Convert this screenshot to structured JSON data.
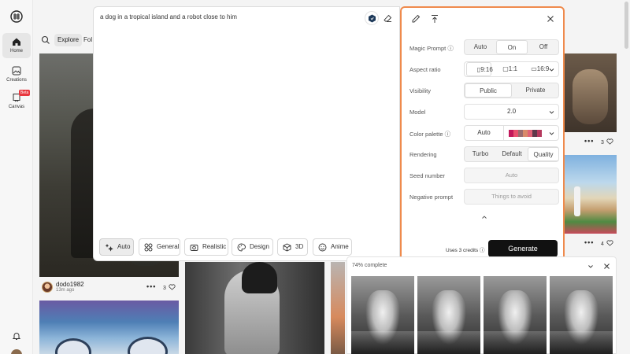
{
  "sidebar": {
    "items": [
      {
        "label": "Home",
        "icon": "home-icon"
      },
      {
        "label": "Creations",
        "icon": "image-icon"
      },
      {
        "label": "Canvas",
        "icon": "canvas-icon",
        "badge": "Beta"
      }
    ]
  },
  "header": {
    "tabs": [
      {
        "label": "Explore"
      },
      {
        "label": "Fol"
      }
    ]
  },
  "prompt": {
    "text": "a dog in a tropical island and a robot close to him"
  },
  "styles": [
    {
      "label": "Auto",
      "icon": "sparkle-icon"
    },
    {
      "label": "General",
      "icon": "grid-icon"
    },
    {
      "label": "Realistic",
      "icon": "camera-icon"
    },
    {
      "label": "Design",
      "icon": "palette-icon"
    },
    {
      "label": "3D",
      "icon": "cube-icon"
    },
    {
      "label": "Anime",
      "icon": "smile-icon"
    }
  ],
  "settings": {
    "magic_prompt": {
      "label": "Magic Prompt",
      "options": [
        "Auto",
        "On",
        "Off"
      ],
      "selected": "On"
    },
    "aspect_ratio": {
      "label": "Aspect ratio",
      "options": [
        "9:16",
        "1:1",
        "16:9"
      ],
      "selected": "9:16"
    },
    "visibility": {
      "label": "Visibility",
      "options": [
        "Public",
        "Private"
      ],
      "selected": "Public"
    },
    "model": {
      "label": "Model",
      "value": "2.0"
    },
    "color_palette": {
      "label": "Color palette",
      "value": "Auto",
      "colors": [
        "#c2185b",
        "#e8506e",
        "#9a6b6f",
        "#d98a6a",
        "#e06377",
        "#5e3a4c",
        "#b5395e"
      ]
    },
    "rendering": {
      "label": "Rendering",
      "options": [
        "Turbo",
        "Default",
        "Quality"
      ],
      "selected": "Quality"
    },
    "seed": {
      "label": "Seed number",
      "placeholder": "Auto"
    },
    "negative": {
      "label": "Negative prompt",
      "placeholder": "Things to avoid"
    },
    "credits": "Uses 3 credits",
    "generate_label": "Generate"
  },
  "gallery": {
    "user": {
      "name": "dodo1982",
      "time": "13m ago"
    },
    "likes": [
      "3",
      "3",
      "4"
    ]
  },
  "progress": {
    "label": "74% complete",
    "percent": 74
  }
}
